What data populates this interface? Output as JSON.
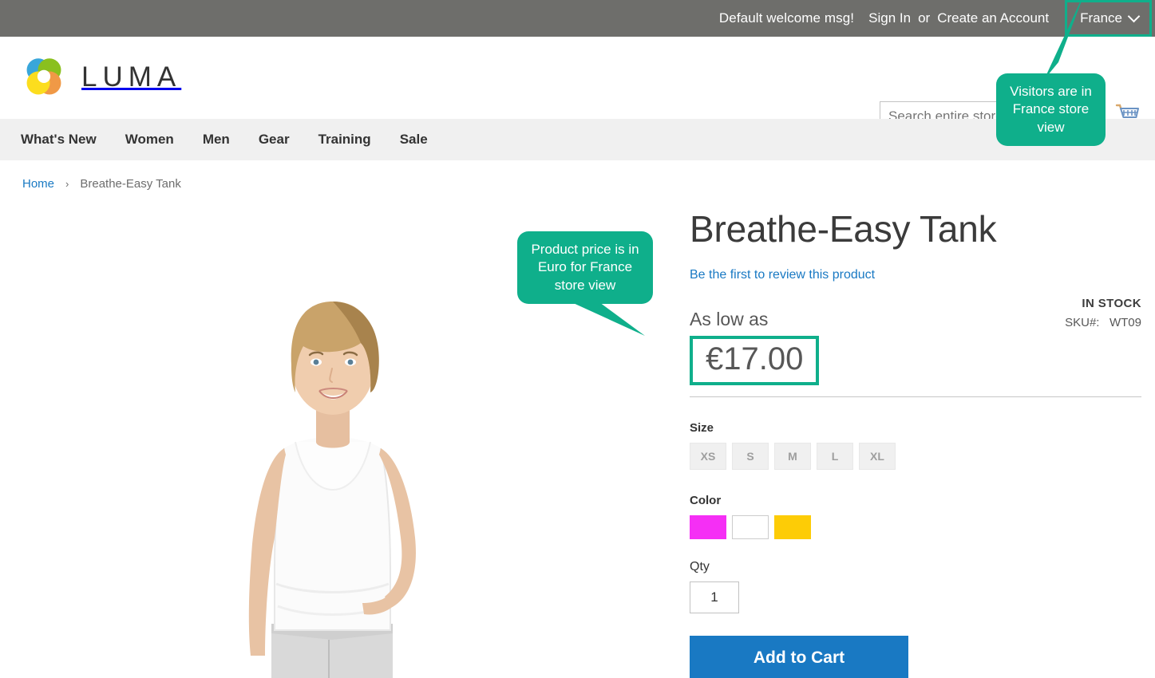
{
  "top_panel": {
    "welcome_message": "Default welcome msg!",
    "sign_in_label": "Sign In",
    "or_label": "or",
    "create_account_label": "Create an Account",
    "store_switcher_value": "France",
    "chevron_icon": "chevron-down-icon",
    "background_color": "#6e6e6b",
    "highlight_color": "#0faf8b"
  },
  "header": {
    "logo_text": "LUMA",
    "logo_icon": "luma-pinwheel-logo",
    "cart_icon": "shopping-cart-icon",
    "search": {
      "placeholder": "Search entire store...",
      "value": "",
      "icon": "search-icon"
    }
  },
  "nav": {
    "items": [
      {
        "label": "What's New"
      },
      {
        "label": "Women"
      },
      {
        "label": "Men"
      },
      {
        "label": "Gear"
      },
      {
        "label": "Training"
      },
      {
        "label": "Sale"
      }
    ]
  },
  "breadcrumb": {
    "home_label": "Home",
    "separator": "›",
    "current_label": "Breathe-Easy Tank"
  },
  "gallery": {
    "alt": "Woman wearing white Breathe-Easy Tank and grey shorts"
  },
  "product": {
    "title": "Breathe-Easy Tank",
    "review_link_label": "Be the first to review this product",
    "stock_status": "IN STOCK",
    "sku_label": "SKU#:",
    "sku_value": "WT09",
    "price_prefix": "As low as",
    "price": "€17.00",
    "price_currency_symbol": "€",
    "price_amount": "17.00",
    "size": {
      "label": "Size",
      "options": [
        {
          "label": "XS"
        },
        {
          "label": "S"
        },
        {
          "label": "M"
        },
        {
          "label": "L"
        },
        {
          "label": "XL"
        }
      ]
    },
    "color": {
      "label": "Color",
      "options": [
        {
          "name": "Purple",
          "hex": "#f52ff5"
        },
        {
          "name": "White",
          "hex": "#ffffff"
        },
        {
          "name": "Yellow",
          "hex": "#fdcc06"
        }
      ]
    },
    "qty": {
      "label": "Qty",
      "value": "1"
    },
    "add_to_cart_label": "Add to Cart"
  },
  "callouts": [
    {
      "id": "france-store-view",
      "text": "Visitors are in France store view",
      "color": "#0faf8b"
    },
    {
      "id": "euro-price",
      "text": "Product price is in Euro for France store view",
      "color": "#0faf8b"
    }
  ]
}
